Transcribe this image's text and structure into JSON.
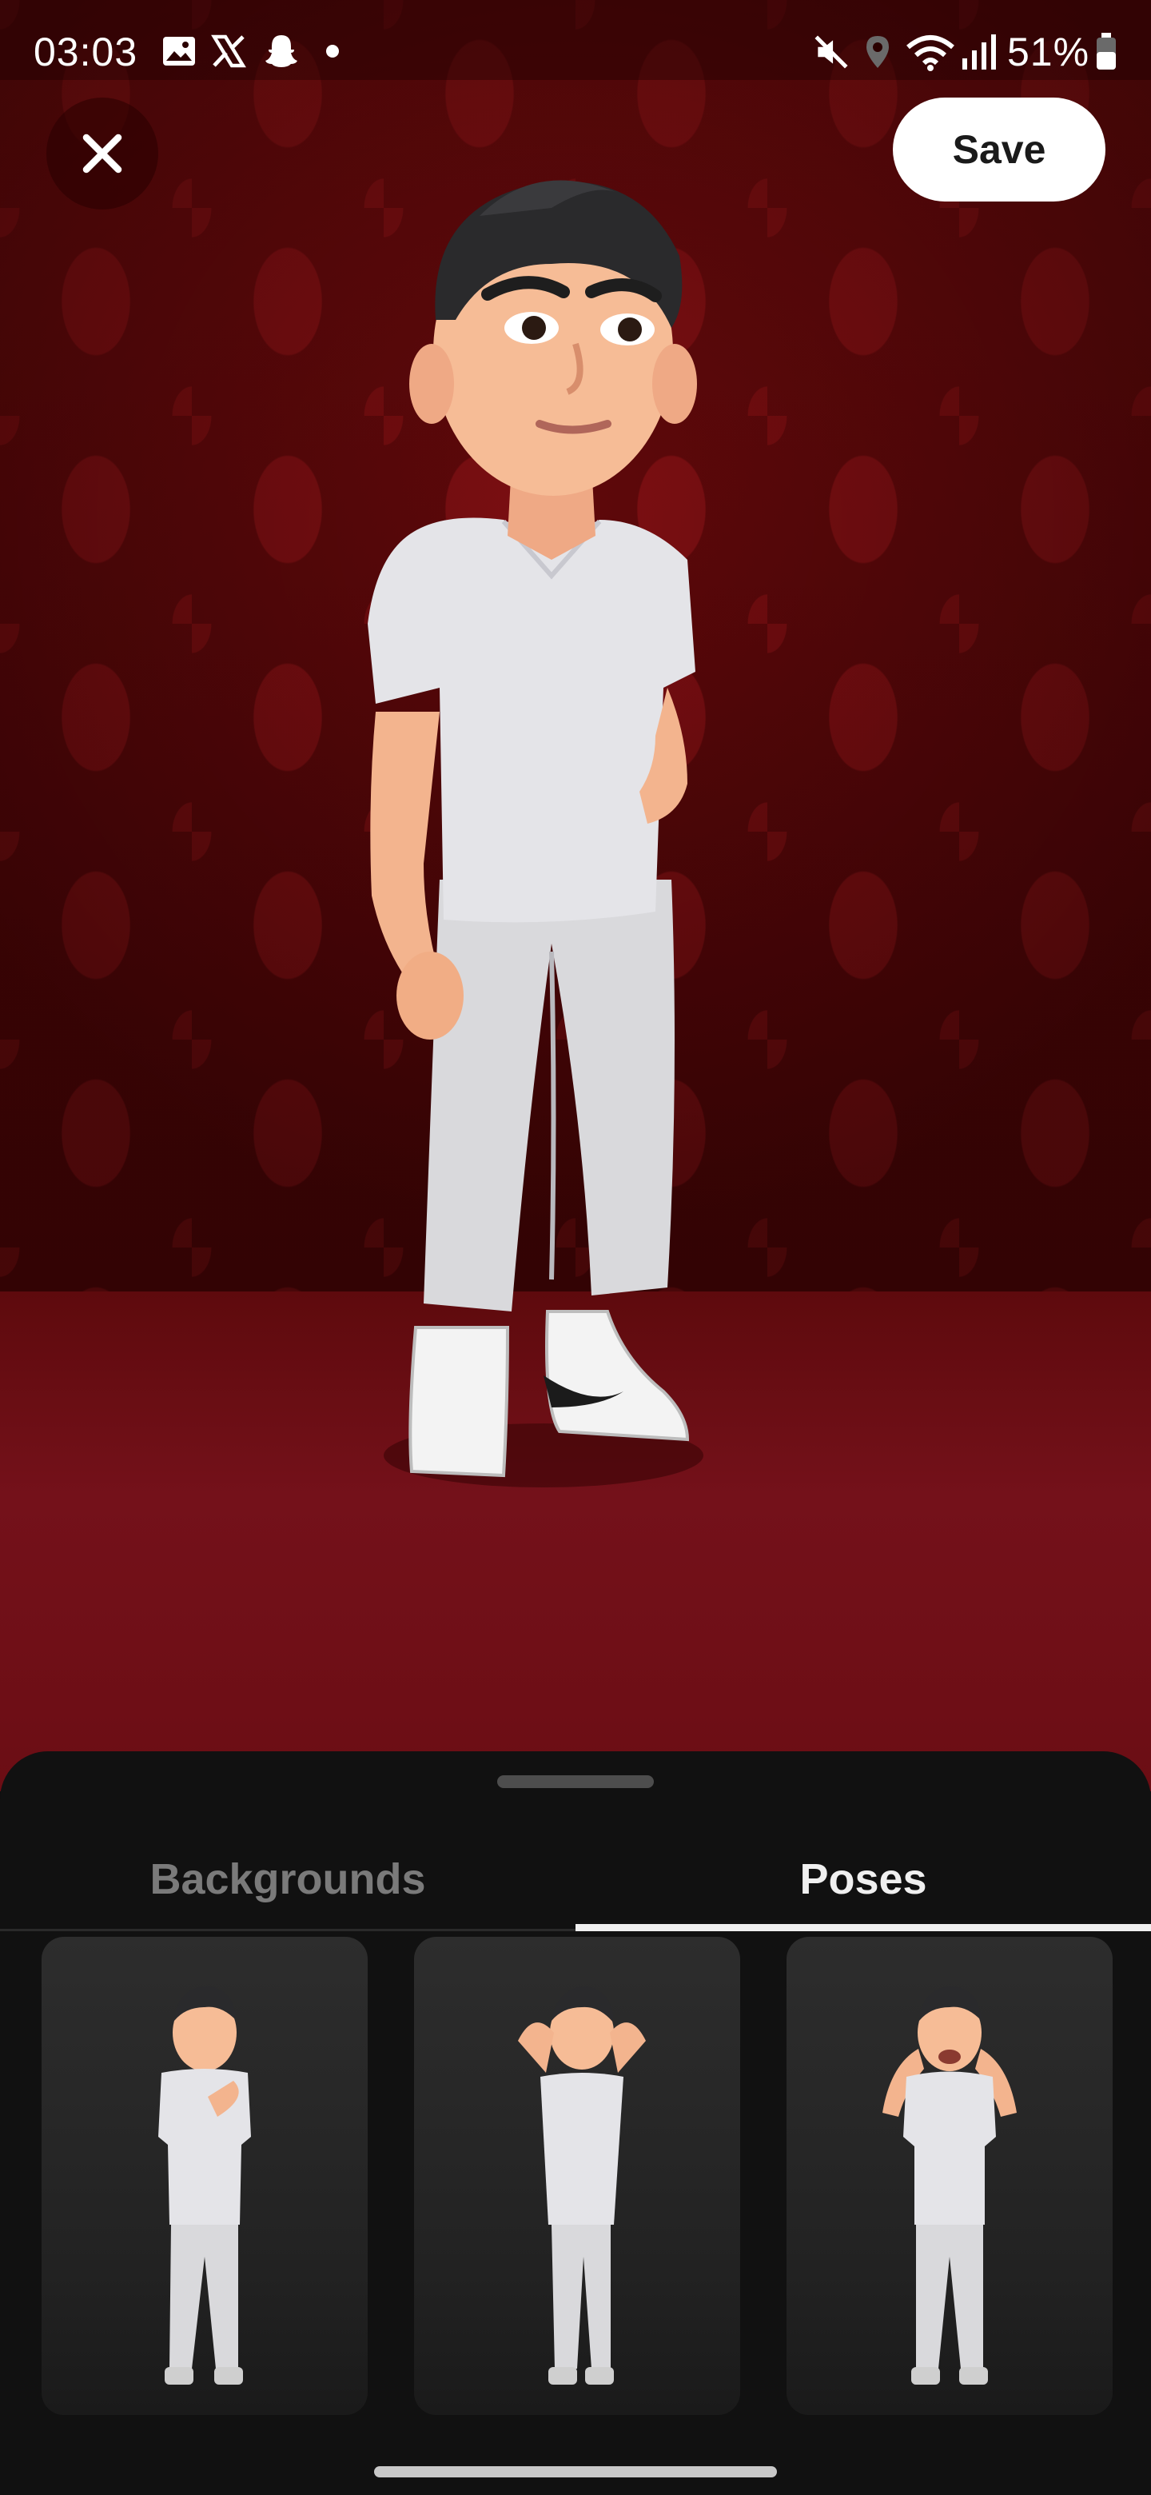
{
  "status_bar": {
    "time": "03:03",
    "battery": "51%",
    "left_icons": [
      "gallery-icon",
      "x-icon",
      "snapchat-icon",
      "dot-icon"
    ],
    "right_icons": [
      "mute-icon",
      "location-icon",
      "wifi-icon",
      "signal-icon",
      "battery-icon"
    ]
  },
  "header": {
    "save_label": "Save",
    "close_icon": "close-icon"
  },
  "tabs": [
    {
      "label": "Backgrounds",
      "active": false
    },
    {
      "label": "Poses",
      "active": true
    }
  ],
  "poses": [
    {
      "name": "hand-on-chin"
    },
    {
      "name": "hands-behind-head"
    },
    {
      "name": "hands-on-cheeks"
    }
  ],
  "colors": {
    "wall": "#5a0709",
    "floor": "#6b0d14",
    "sheet": "#111111",
    "active_tab": "#f0f0f0",
    "inactive_tab": "#7a7a7a"
  }
}
